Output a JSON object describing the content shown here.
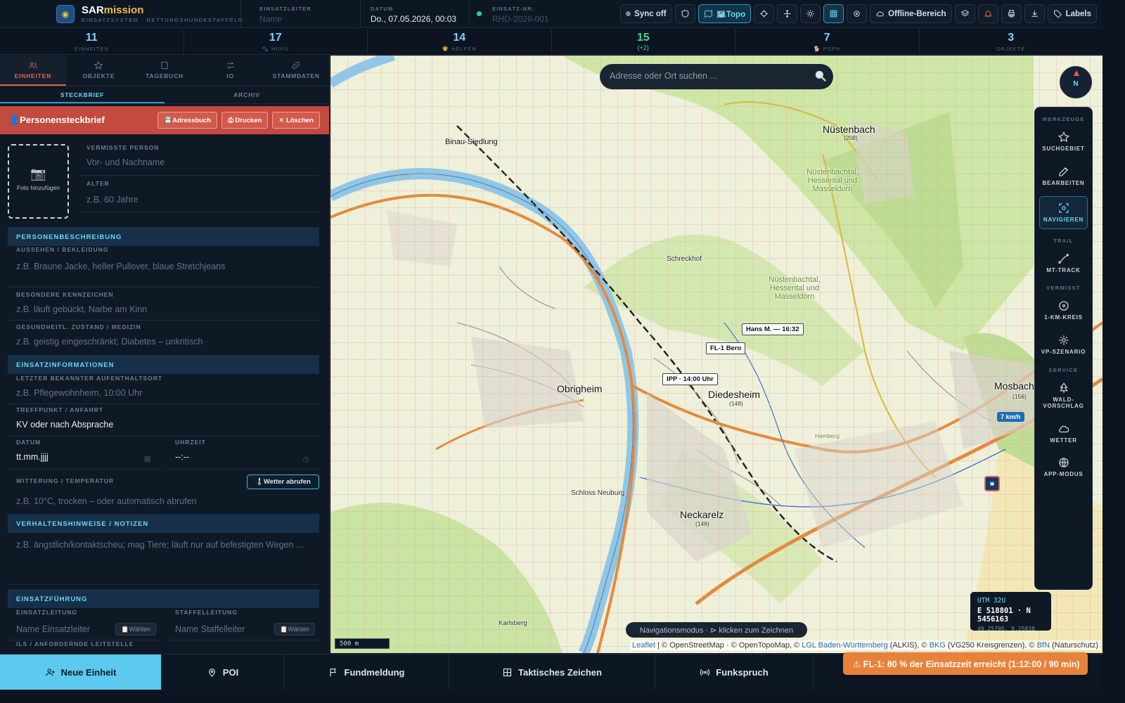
{
  "app": {
    "name_part1": "SAR",
    "name_part2": "mission",
    "subtitle": "EINSATZSYSTEM · RETTUNGSHUNDESTAFFELN"
  },
  "header": {
    "einsatzleiter": {
      "label": "EINSATZLEITER",
      "placeholder": "Name"
    },
    "datum": {
      "label": "DATUM",
      "value": "Do., 07.05.2026, 00:03"
    },
    "einsatznr": {
      "label": "EINSATZ-NR.",
      "placeholder": "RHD-2026-001"
    },
    "buttons": {
      "sync": "Sync off",
      "topo": "🗺️Topo",
      "offline": "Offline-Bereich",
      "labels": "Labels"
    }
  },
  "stats": [
    {
      "value": "11",
      "label": "EINHEITEN"
    },
    {
      "value": "17",
      "label": "🐾 HUFÜ"
    },
    {
      "value": "14",
      "label": "🦁 HELFER"
    },
    {
      "value": "15",
      "label": "(+2)",
      "color": "#4bd38a"
    },
    {
      "value": "7",
      "label": "🐕 PSPH"
    },
    {
      "value": "3",
      "label": "OBJEKTE"
    }
  ],
  "sidebar": {
    "tabs": [
      "EINHEITEN",
      "OBJEKTE",
      "TAGEBUCH",
      "IO",
      "STAMMDATEN"
    ],
    "subtabs": [
      "STECKBRIEF",
      "ARCHIV"
    ],
    "profile": {
      "title": "👤Personensteckbrief",
      "buttons": {
        "adressbuch": "📇Adressbuch",
        "drucken": "⎙ Drucken",
        "loeschen": "✕ Löschen"
      },
      "photo": "Foto hinzufügen",
      "vermisste_person": {
        "label": "VERMISSTE PERSON",
        "placeholder": "Vor- und Nachname"
      },
      "alter": {
        "label": "ALTER",
        "placeholder": "z.B. 60 Jahre"
      }
    },
    "sections": {
      "personenbeschreibung": "PERSONENBESCHREIBUNG",
      "einsatzinformationen": "EINSATZINFORMATIONEN",
      "verhaltenshinweise": "VERHALTENSHINWEISE / NOTIZEN",
      "einsatzfuehrung": "EINSATZFÜHRUNG"
    },
    "fields": {
      "aussehen": {
        "label": "AUSSEHEN / BEKLEIDUNG",
        "placeholder": "z.B. Braune Jacke, heller Pullover, blaue Stretchjeans"
      },
      "kennzeichen": {
        "label": "BESONDERE KENNZEICHEN",
        "placeholder": "z.B. läuft gebückt, Narbe am Kinn"
      },
      "gesundheit": {
        "label": "GESUNDHEITL. ZUSTAND / MEDIZIN",
        "placeholder": "z.B. geistig eingeschränkt; Diabetes – unkritisch"
      },
      "aufenthaltsort": {
        "label": "LETZTER BEKANNTER AUFENTHALTSORT",
        "placeholder": "z.B. Pflegewohnheim, 10:00 Uhr"
      },
      "treffpunkt": {
        "label": "TREFFPUNKT / ANFAHRT",
        "value": "KV oder nach Absprache"
      },
      "datum": {
        "label": "DATUM",
        "placeholder": "tt.mm.jjjj"
      },
      "uhrzeit": {
        "label": "UHRZEIT",
        "placeholder": "--:--"
      },
      "witterung": {
        "label": "WITTERUNG / TEMPERATUR",
        "placeholder": "z.B. 10°C, trocken – oder automatisch abrufen",
        "button": "🌡️Wetter abrufen"
      },
      "notizen": {
        "placeholder": "z.B. ängstlich/kontaktscheu; mag Tiere; läuft nur auf befestigten Wegen ..."
      },
      "einsatzleitung": {
        "label": "EINSATZLEITUNG",
        "placeholder": "Name Einsatzleiter",
        "button": "📋Wählen"
      },
      "staffelleitung": {
        "label": "STAFFELLEITUNG",
        "placeholder": "Name Staffelleiter",
        "button": "📋Wählen"
      },
      "ils": {
        "label": "ILS / ANFORDERNDE LEITSTELLE"
      }
    }
  },
  "map": {
    "search_placeholder": "Adresse oder Ort suchen ...",
    "compass": "N",
    "tools": {
      "werkzeuge": "WERKZEUGE",
      "suchgebiet": "SUCHGEBIET",
      "bearbeiten": "BEARBEITEN",
      "navigieren": "NAVIGIEREN",
      "trail": "TRAIL",
      "mttrack": "MT-TRACK",
      "vermisst": "VERMISST",
      "kreis": "1-KM-KREIS",
      "vp": "VP-SZENARIO",
      "service": "SERVICE",
      "wald": "WALD-VORSCHLAG",
      "wetter": "WETTER",
      "app": "APP-MODUS"
    },
    "labels": {
      "hans": "Hans M. — 16:32",
      "fl1": "FL-1 Bero",
      "ipp": "IPP · 14:00 Uhr",
      "kmh": "7 km/h"
    },
    "towns": [
      "Nüstenbach",
      "(208)",
      "Binau-Siedlung",
      "Schreckhof",
      "Obrigheim",
      "Diedesheim",
      "(148)",
      "Neckarelz",
      "(148)",
      "Schloss Neuburg",
      "Karlsberg",
      "Mosbach",
      "(156)",
      "Nüstenbachtal, Hessental und Masseldorn",
      "Nüstenbachtal, Hessental und Masseldorn",
      "Hamberg"
    ],
    "coords": {
      "zone": "UTM 32U",
      "en": "E 518801 · N 5456163",
      "latlon": "49.25795, 9.25838"
    },
    "nav_mode": "Navigationsmodus · ⊳ klicken zum Zeichnen",
    "scale": "500 m",
    "attribution": {
      "leaflet": "Leaflet",
      "osm": " | © OpenStreetMap · © OpenTopoMap, © ",
      "lgl": "LGL Baden-Württemberg",
      "alkis": " (ALKIS), © ",
      "bkg": "BKG",
      "vg": " (VG250 Kreisgrenzen), © ",
      "bfn": "BfN",
      "nat": " (Naturschutz)"
    }
  },
  "bottom": {
    "neue_einheit": "Neue Einheit",
    "poi": "POI",
    "fundmeldung": "Fundmeldung",
    "taktisch": "Taktisches Zeichen",
    "funkspruch": "Funkspruch"
  },
  "alert": "⚠ FL-1: 80 % der Einsatzzeit erreicht (1:12:00 / 90 min)"
}
